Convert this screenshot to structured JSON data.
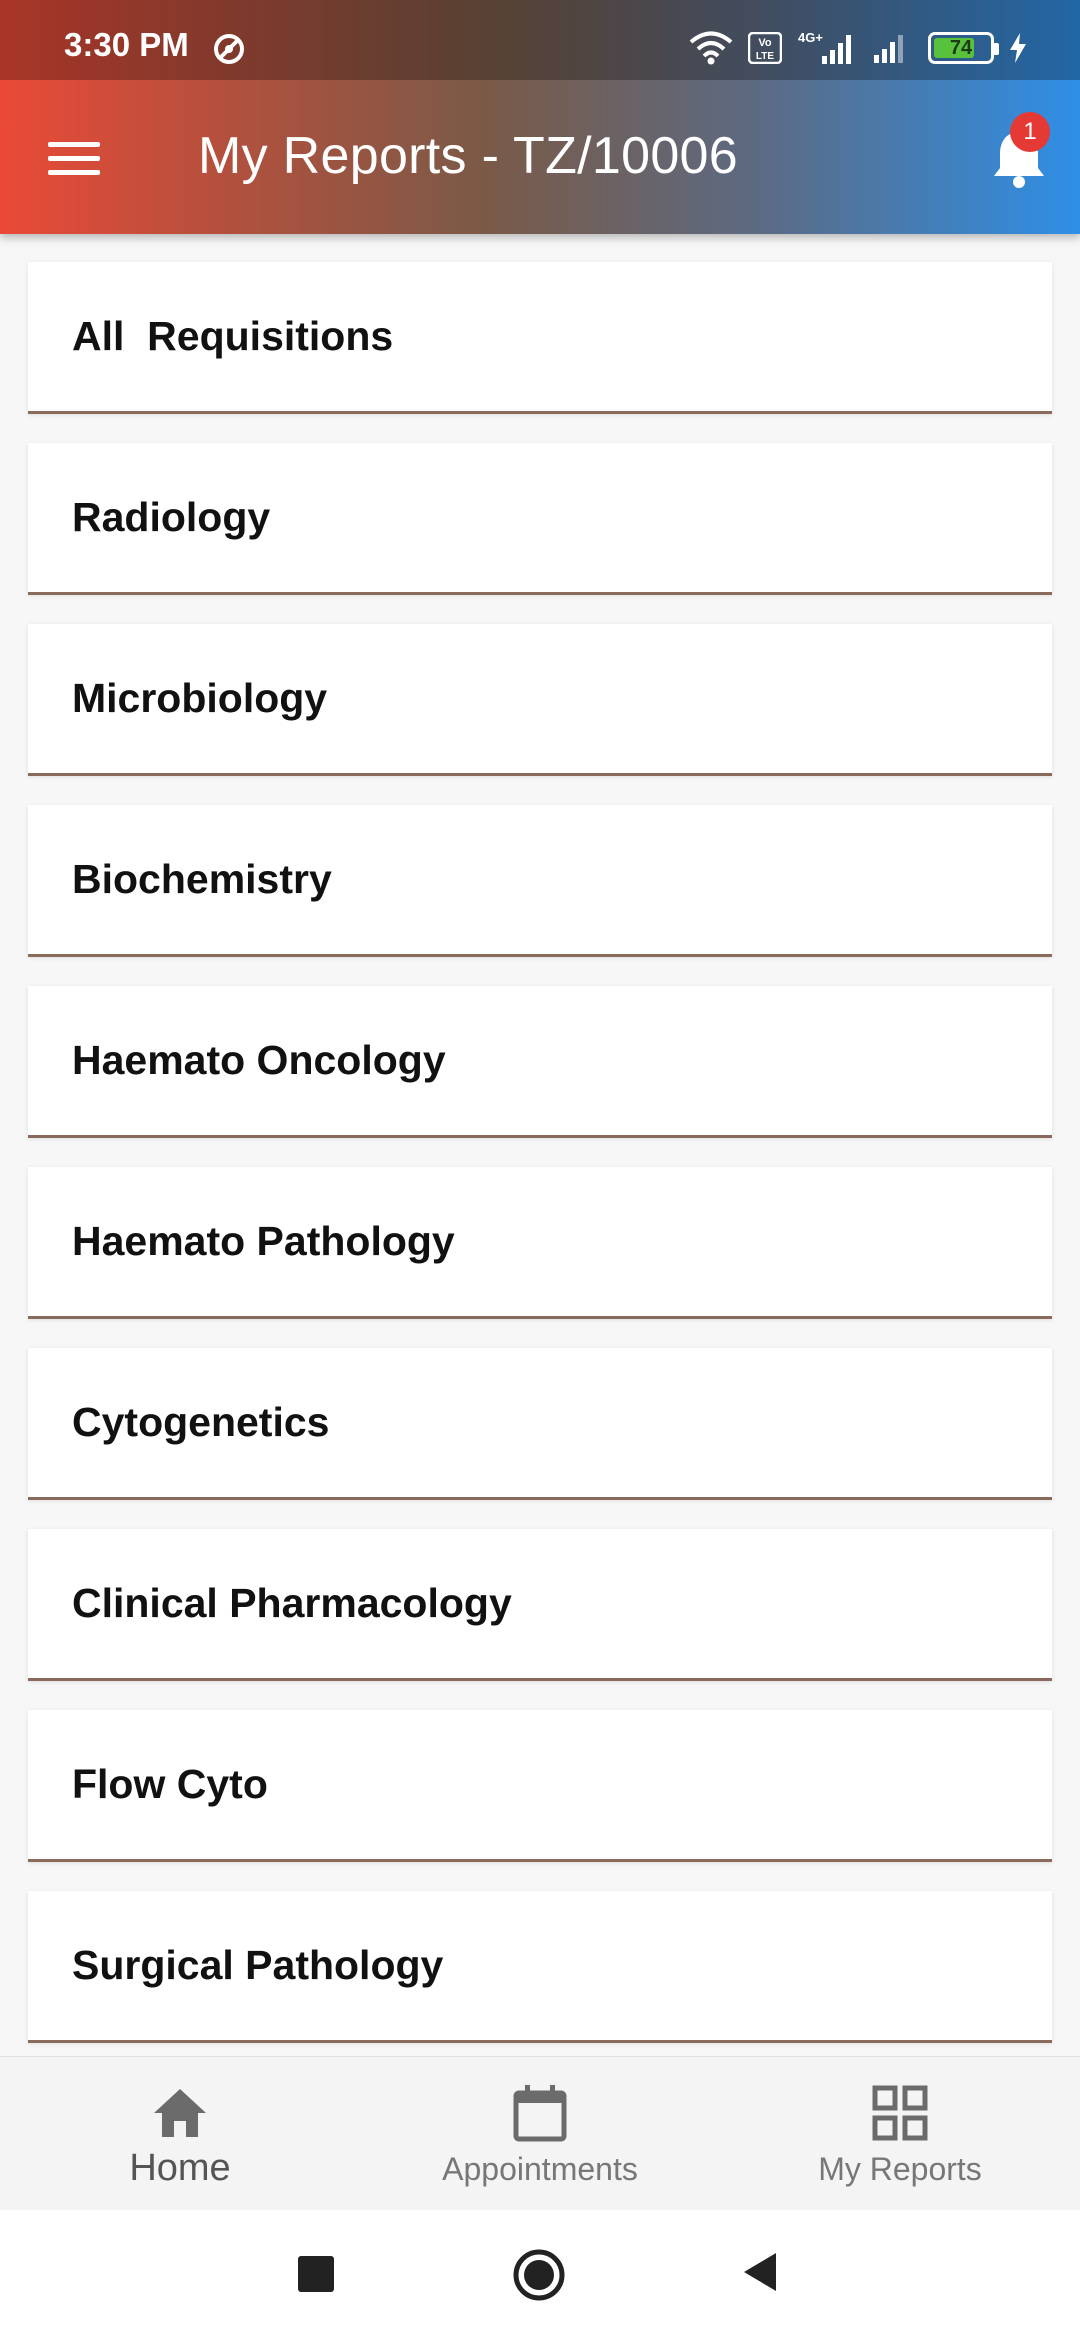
{
  "status_bar": {
    "time": "3:30 PM",
    "battery_level": "74",
    "network_label": "4G+",
    "volte_label": "Vo LTE"
  },
  "app_bar": {
    "title": "My Reports - TZ/10006",
    "notification_count": "1"
  },
  "reports": [
    {
      "label": "All  Requisitions"
    },
    {
      "label": "Radiology"
    },
    {
      "label": "Microbiology"
    },
    {
      "label": "Biochemistry"
    },
    {
      "label": "Haemato Oncology"
    },
    {
      "label": "Haemato Pathology"
    },
    {
      "label": "Cytogenetics"
    },
    {
      "label": "Clinical Pharmacology"
    },
    {
      "label": "Flow Cyto"
    },
    {
      "label": "Surgical Pathology"
    }
  ],
  "bottom_nav": {
    "items": [
      {
        "label": "Home",
        "icon": "home-icon"
      },
      {
        "label": "Appointments",
        "icon": "calendar-icon"
      },
      {
        "label": "My Reports",
        "icon": "grid-icon"
      }
    ]
  },
  "colors": {
    "gradient_start": "#ea4a37",
    "gradient_end": "#2f8fe6",
    "badge": "#e53935",
    "card_border": "#8a6a5c",
    "battery": "#59c23c"
  }
}
